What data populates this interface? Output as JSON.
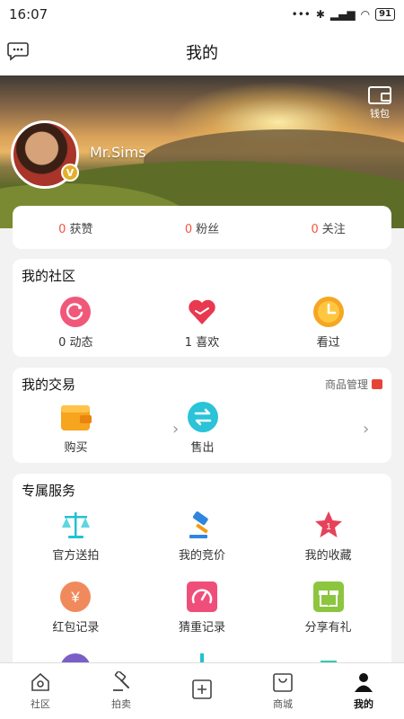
{
  "status": {
    "time": "16:07",
    "battery": "91"
  },
  "header": {
    "title": "我的"
  },
  "profile": {
    "username": "Mr.Sims",
    "badge": "V",
    "wallet_label": "钱包"
  },
  "stats": [
    {
      "count": "0",
      "label": "获赞"
    },
    {
      "count": "0",
      "label": "粉丝"
    },
    {
      "count": "0",
      "label": "关注"
    }
  ],
  "community": {
    "title": "我的社区",
    "items": [
      {
        "label": "0 动态",
        "icon": "refresh-icon",
        "color": "#f0587a"
      },
      {
        "label": "1 喜欢",
        "icon": "heart-icon",
        "color": "#e8394f"
      },
      {
        "label": "看过",
        "icon": "clock-icon",
        "color": "#f5a623"
      }
    ]
  },
  "trade": {
    "title": "我的交易",
    "manage_link": "商品管理",
    "items": [
      {
        "label": "购买",
        "icon": "wallet-icon",
        "color": "#f59b23"
      },
      {
        "label": "售出",
        "icon": "exchange-icon",
        "color": "#2ac3d8"
      }
    ]
  },
  "services": {
    "title": "专属服务",
    "items": [
      {
        "label": "官方送拍",
        "icon": "scale-icon",
        "color": "#24c1cf"
      },
      {
        "label": "我的竞价",
        "icon": "gavel-icon",
        "color": "#2e86de"
      },
      {
        "label": "我的收藏",
        "icon": "star-icon",
        "color": "#e6425a"
      },
      {
        "label": "红包记录",
        "icon": "yen-icon",
        "color": "#f08a5d"
      },
      {
        "label": "猜重记录",
        "icon": "gauge-icon",
        "color": "#f04e7a"
      },
      {
        "label": "分享有礼",
        "icon": "gift-icon",
        "color": "#8cc63f"
      }
    ]
  },
  "tabs": [
    {
      "label": "社区",
      "icon": "home-icon"
    },
    {
      "label": "拍卖",
      "icon": "gavel-icon"
    },
    {
      "label": "",
      "icon": "plus-icon"
    },
    {
      "label": "商城",
      "icon": "bag-icon"
    },
    {
      "label": "我的",
      "icon": "person-icon"
    }
  ]
}
